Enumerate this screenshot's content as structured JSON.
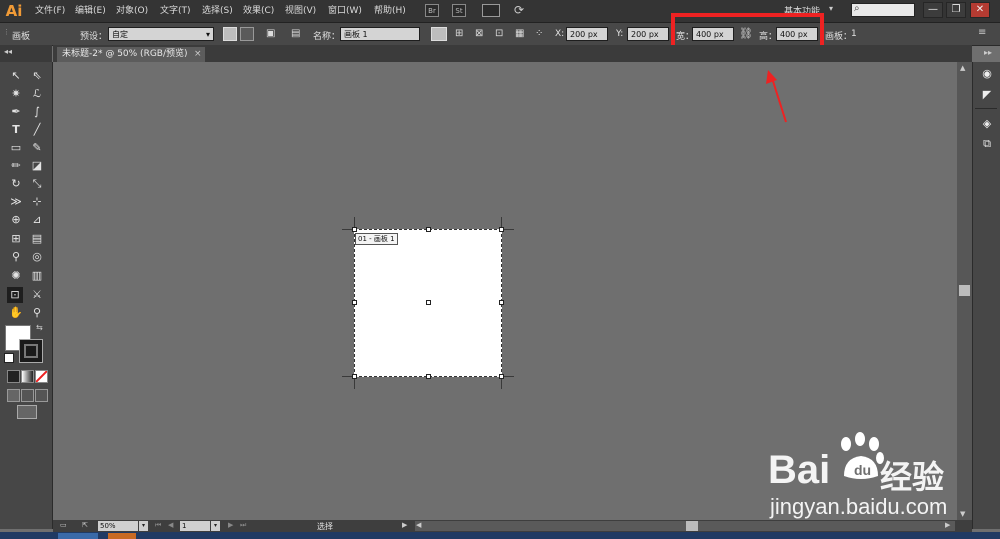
{
  "app": {
    "logo": "Ai",
    "menus": [
      "文件(F)",
      "编辑(E)",
      "对象(O)",
      "文字(T)",
      "选择(S)",
      "效果(C)",
      "视图(V)",
      "窗口(W)",
      "帮助(H)"
    ],
    "bridge_label": "Br",
    "stock_label": "St",
    "workspace": "基本功能",
    "workspace_arrow": "▾",
    "window_buttons": [
      "—",
      "❐",
      "✕"
    ]
  },
  "control_bar": {
    "panel_name": "画板",
    "preset_label": "预设：",
    "preset_value": "自定",
    "name_label": "名称：",
    "name_value": "画板 1",
    "x_label": "X:",
    "x_value": "200 px",
    "y_label": "Y:",
    "y_value": "200 px",
    "width_label": "宽：",
    "width_value": "400 px",
    "height_label": "高：",
    "height_value": "400 px",
    "artboards_label": "画板：",
    "artboards_value": "1"
  },
  "document": {
    "tab_title": "未标题-2* @ 50% (RGB/预览)",
    "tab_close": "×",
    "artboard_label": "01 - 画板 1"
  },
  "status_bar": {
    "zoom": "50%",
    "page": "1",
    "tool": "选择"
  },
  "colors": {
    "highlight": "#ee2222",
    "canvas": "#6f6f6f",
    "ai_orange": "#f09a36"
  },
  "watermark": {
    "brand": "Bai",
    "brand_suffix": "经验",
    "url": "jingyan.baidu.com"
  },
  "icons": [
    "selection-icon",
    "direct-selection-icon",
    "magic-wand-icon",
    "lasso-icon",
    "pen-icon",
    "curvature-icon",
    "type-icon",
    "line-icon",
    "rectangle-icon",
    "paintbrush-icon",
    "pencil-icon",
    "eraser-icon",
    "rotate-icon",
    "scale-icon",
    "width-icon",
    "free-transform-icon",
    "shape-builder-icon",
    "perspective-icon",
    "mesh-icon",
    "gradient-icon",
    "eyedropper-icon",
    "blend-icon",
    "symbol-sprayer-icon",
    "column-graph-icon",
    "artboard-icon",
    "slice-icon",
    "hand-icon",
    "zoom-icon"
  ]
}
